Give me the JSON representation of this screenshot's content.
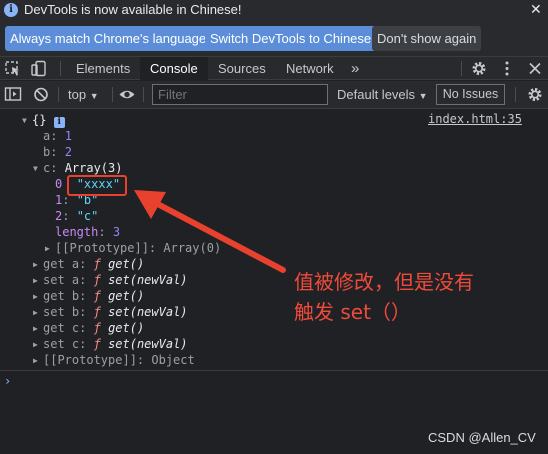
{
  "infobar": {
    "message": "DevTools is now available in Chinese!",
    "buttons": [
      "Always match Chrome's language",
      "Switch DevTools to Chinese",
      "Don't show again"
    ],
    "close": "✕"
  },
  "tabs": [
    "Elements",
    "Console",
    "Sources",
    "Network"
  ],
  "more_tabs": "»",
  "toolbar": {
    "context": "top",
    "filter_placeholder": "Filter",
    "levels": "Default levels",
    "issues": "No Issues"
  },
  "console": {
    "source_link": "index.html:35",
    "object_preview": "{}",
    "info_badge": "i",
    "props": [
      {
        "key": "a",
        "value": "1"
      },
      {
        "key": "b",
        "value": "2"
      }
    ],
    "array_key": "c",
    "array_label": "Array(3)",
    "array_items": [
      {
        "index": "0",
        "value": "\"xxxx\""
      },
      {
        "index": "1",
        "value": "\"b\""
      },
      {
        "index": "2",
        "value": "\"c\""
      }
    ],
    "length_key": "length",
    "length_value": "3",
    "array_proto": "[[Prototype]]: Array(0)",
    "accessors": [
      {
        "label": "get a:",
        "sig": "get()"
      },
      {
        "label": "set a:",
        "sig": "set(newVal)"
      },
      {
        "label": "get b:",
        "sig": "get()"
      },
      {
        "label": "set b:",
        "sig": "set(newVal)"
      },
      {
        "label": "get c:",
        "sig": "get()"
      },
      {
        "label": "set c:",
        "sig": "set(newVal)"
      }
    ],
    "f_symbol": "ƒ",
    "object_proto": "[[Prototype]]: Object",
    "prompt": "›"
  },
  "annotation": {
    "line1": "值被修改，但是没有",
    "line2": "触发 set（）",
    "color": "#f04a3b"
  },
  "watermark": "CSDN @Allen_CV"
}
